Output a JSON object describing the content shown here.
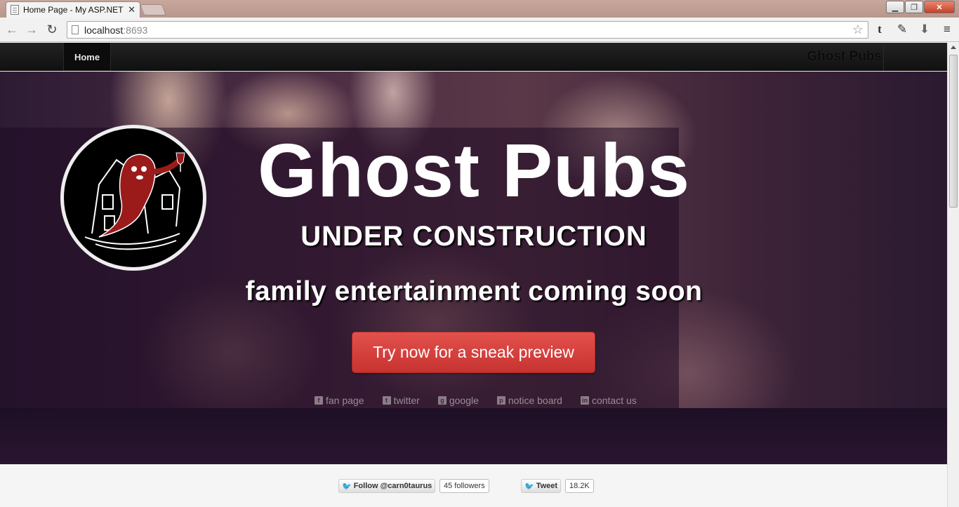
{
  "browser": {
    "tab_title": "Home Page - My ASP.NET",
    "tab_close": "✕",
    "url_host": "localhost",
    "url_port": ":8693",
    "window_controls": {
      "minimize": "▁",
      "maximize": "❐",
      "close": "✕"
    }
  },
  "navbar": {
    "home_label": "Home",
    "brand": "Ghost Pubs"
  },
  "hero": {
    "title": "Ghost Pubs",
    "subtitle": "UNDER CONSTRUCTION",
    "tagline": "family entertainment coming soon",
    "cta_label": "Try now for a sneak preview"
  },
  "social": [
    {
      "icon": "facebook-icon",
      "glyph": "f",
      "label": "fan page"
    },
    {
      "icon": "twitter-icon",
      "glyph": "t",
      "label": "twitter"
    },
    {
      "icon": "google-icon",
      "glyph": "g",
      "label": "google"
    },
    {
      "icon": "pinterest-icon",
      "glyph": "p",
      "label": "notice board"
    },
    {
      "icon": "linkedin-icon",
      "glyph": "in",
      "label": "contact us"
    }
  ],
  "footer": {
    "follow_label": "Follow @carn0taurus",
    "followers": "45 followers",
    "tweet_label": "Tweet",
    "tweet_count": "18.2K"
  },
  "colors": {
    "cta": "#d9423e",
    "navbar": "#1b1b1b",
    "twitter_blue": "#2ea7df"
  }
}
